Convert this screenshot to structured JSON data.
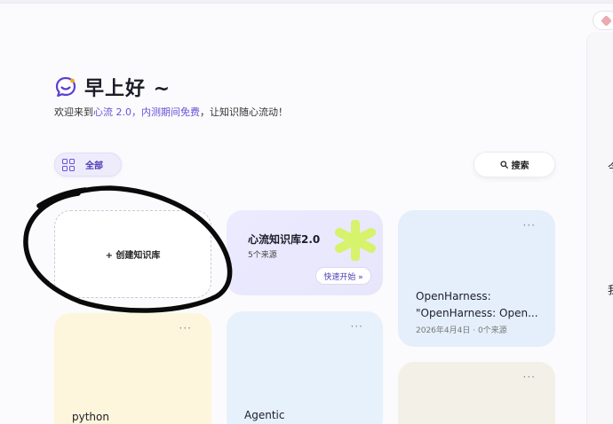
{
  "greeting": {
    "title": "早上好 ~",
    "subtitle_prefix": "欢迎来到",
    "subtitle_accent": "心流 2.0，内测期间免费",
    "subtitle_suffix": "，让知识随心流动！"
  },
  "filters": {
    "active_label": "全部"
  },
  "search": {
    "label": "搜索"
  },
  "create_card": {
    "label": "+ 创建知识库"
  },
  "featured_card": {
    "title": "心流知识库2.0",
    "sources": "5个来源",
    "button_label": "快速开始 »"
  },
  "knowledge_bases": [
    {
      "title_line1": "OpenHarness:",
      "title_line2": "\"OpenHarness: Open...",
      "meta": "2026年4月4日 · 0个来源"
    },
    {
      "title": "python"
    },
    {
      "title": "Agentic"
    },
    {
      "title": ""
    }
  ],
  "right_panel": {
    "glyph_top": "今",
    "glyph_mid": "我"
  },
  "colors": {
    "accent": "#6b4fd9",
    "featured_star": "#d7f26b",
    "card_blue": "#e4effb",
    "card_yellow": "#fdf6dc",
    "card_beige": "#f3f0e8"
  },
  "icons": {
    "logo": "chat-bubble-logo-icon",
    "filter": "grid-icon",
    "search": "search-icon",
    "more": "more-dots-icon",
    "star": "asterisk-star-icon"
  }
}
